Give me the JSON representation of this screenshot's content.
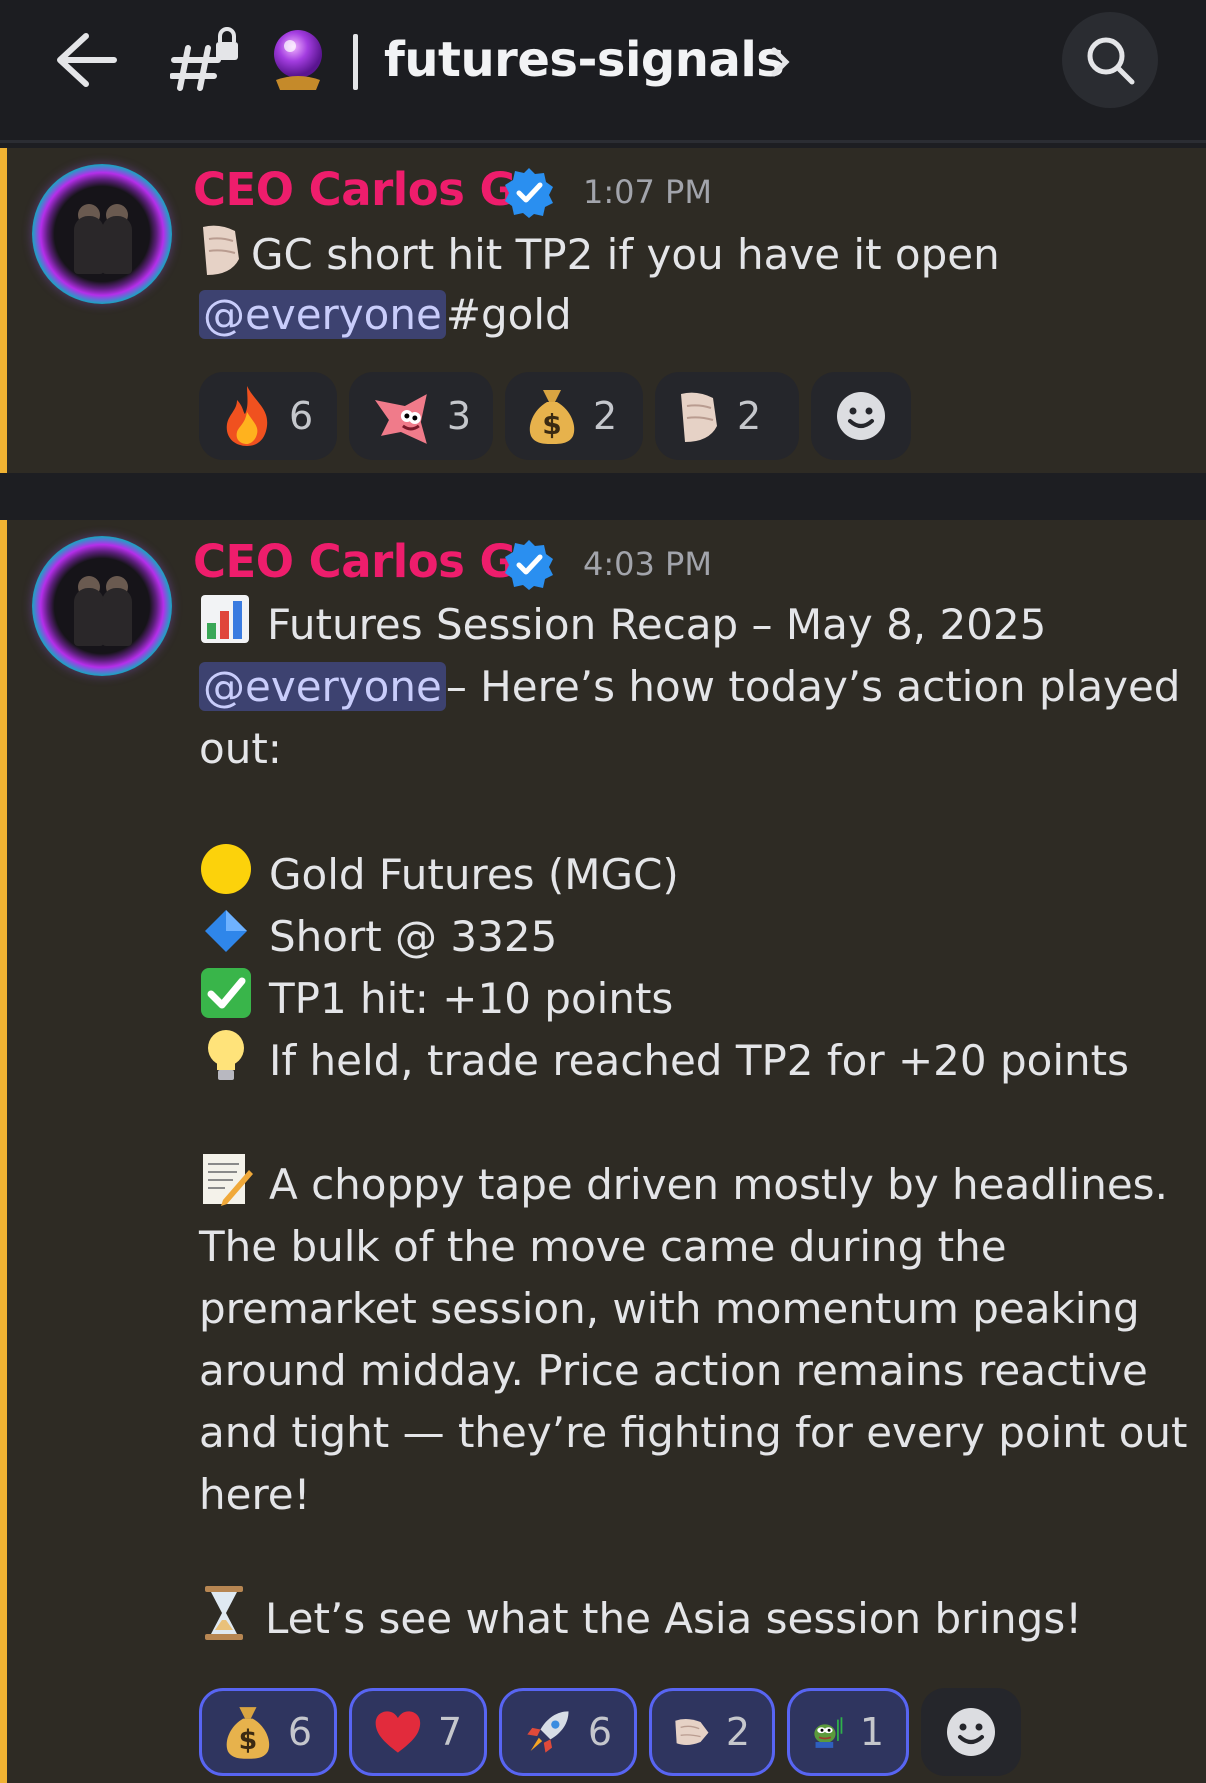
{
  "header": {
    "channel_name": "futures-signals",
    "icons": [
      "back-arrow-icon",
      "hash-lock-icon",
      "crystal-ball-icon",
      "chevron-right-icon",
      "search-icon"
    ]
  },
  "messages": [
    {
      "author": "CEO Carlos G.",
      "time": "1:07 PM",
      "line1": " GC short  hit TP2 if you have it open",
      "mention": "@everyone",
      "tag": " #gold",
      "reactions": [
        {
          "emoji": "fire",
          "count": "6"
        },
        {
          "emoji": "patrick",
          "count": "3"
        },
        {
          "emoji": "money-bag",
          "count": "2"
        },
        {
          "emoji": "fist",
          "count": "2"
        }
      ]
    },
    {
      "author": "CEO Carlos G.",
      "time": "4:03 PM",
      "title": "Futures Session Recap – May 8, 2025",
      "mention": "@everyone",
      "after_mention": " – Here’s how today’s action played",
      "after_mention_2": "out:",
      "bullets": [
        {
          "icon": "yellow-circle",
          "text": "Gold Futures (MGC)"
        },
        {
          "icon": "blue-diamond",
          "text": "Short @ 3325"
        },
        {
          "icon": "check-mark",
          "text": "TP1 hit: +10 points"
        },
        {
          "icon": "light-bulb",
          "text": "If held, trade reached TP2 for +20 points"
        }
      ],
      "para_lines": [
        "A choppy tape driven mostly by headlines.",
        "The bulk of the move came during the",
        "premarket session, with momentum peaking",
        "around midday. Price action remains reactive",
        "and tight — they’re fighting for every point out",
        "here!"
      ],
      "closing": "Let’s see what the Asia session brings!",
      "reactions": [
        {
          "emoji": "money-bag",
          "count": "6"
        },
        {
          "emoji": "heart",
          "count": "7"
        },
        {
          "emoji": "rocket",
          "count": "6"
        },
        {
          "emoji": "fist",
          "count": "2"
        },
        {
          "emoji": "pepe",
          "count": "1"
        }
      ]
    }
  ],
  "colors": {
    "accent_bar": "#f0b232",
    "author": "#ee1d6c",
    "mention_bg": "#3d4270",
    "reaction_selected_border": "#5865f2"
  }
}
